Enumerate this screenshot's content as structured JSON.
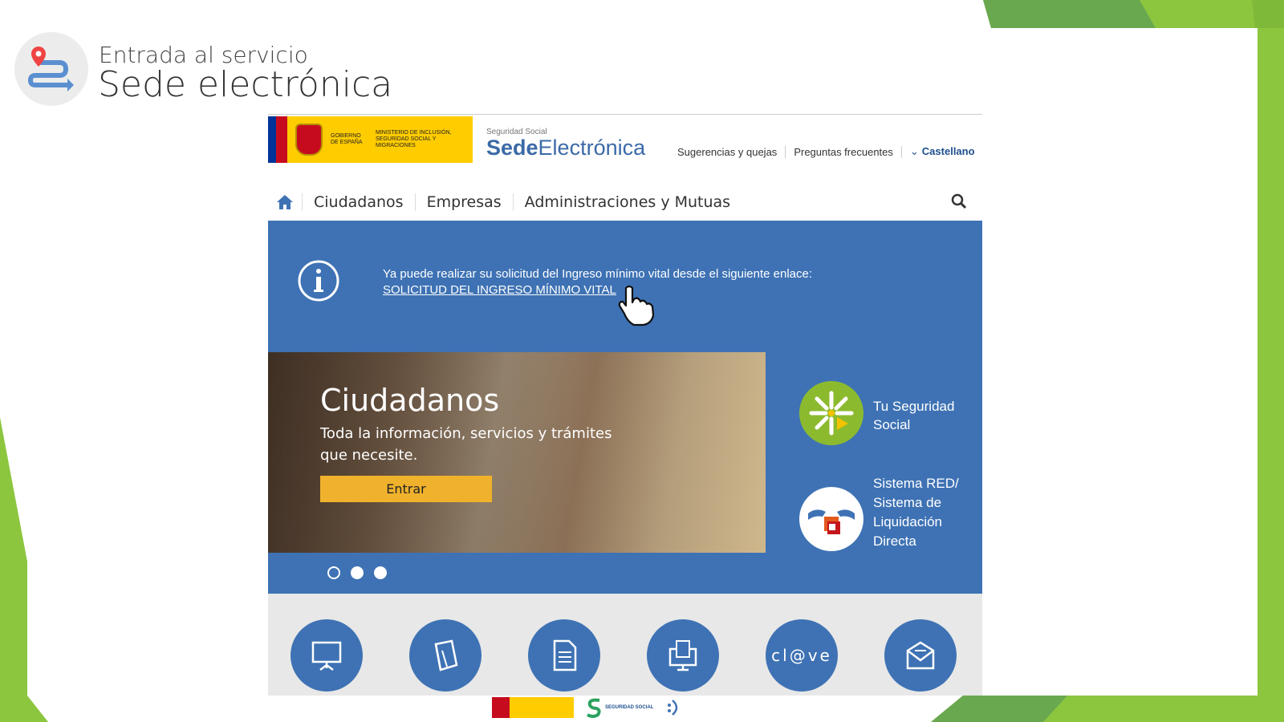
{
  "slide": {
    "subtitle": "Entrada al servicio",
    "title": "Sede electrónica"
  },
  "site": {
    "gob_text_1": "GOBIERNO DE ESPAÑA",
    "gob_text_2": "MINISTERIO DE INCLUSIÓN, SEGURIDAD SOCIAL Y MIGRACIONES",
    "brand_small": "Seguridad Social",
    "brand_bold": "Sede",
    "brand_rest": "Electrónica",
    "top_links": [
      "Sugerencias y quejas",
      "Preguntas frecuentes"
    ],
    "language": "Castellano"
  },
  "nav": {
    "items": [
      "Ciudadanos",
      "Empresas",
      "Administraciones y Mutuas"
    ]
  },
  "notice": {
    "message": "Ya puede realizar su solicitud del Ingreso mínimo vital desde el siguiente enlace:",
    "link": "SOLICITUD DEL INGRESO MÍNIMO VITAL"
  },
  "hero": {
    "heading": "Ciudadanos",
    "description": "Toda la información, servicios y trámites que necesite.",
    "button": "Entrar",
    "active_slide": 1,
    "slide_count": 3
  },
  "side": {
    "item1": "Tu Seguridad Social",
    "item2": "Sistema RED/ Sistema de Liquidación Directa"
  },
  "tiles": {
    "clave": "cl@ve"
  },
  "footer": {
    "ss_logo_text": "SEGURIDAD SOCIAL"
  },
  "colors": {
    "accent_blue": "#3e72b4",
    "slide_green": "#8cc63f",
    "button_yellow": "#f0b22c"
  }
}
